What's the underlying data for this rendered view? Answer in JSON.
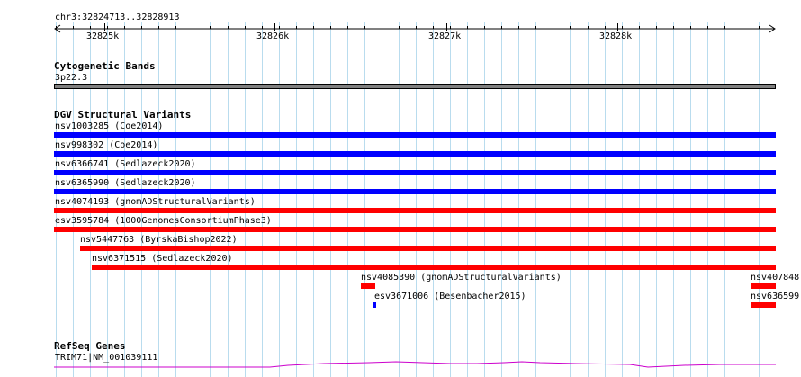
{
  "ruler": {
    "region": "chr3:32824713..32828913",
    "ticks": [
      "32825k",
      "32826k",
      "32827k",
      "32828k"
    ]
  },
  "tracks": {
    "cyto": {
      "title": "Cytogenetic Bands",
      "band_label": "3p22.3",
      "band_color": "#808080"
    },
    "dgv": {
      "title": "DGV Structural Variants",
      "features": [
        {
          "label": "nsv1003285 (Coe2014)",
          "color": "#0000ff"
        },
        {
          "label": "nsv998302 (Coe2014)",
          "color": "#0000ff"
        },
        {
          "label": "nsv6366741 (Sedlazeck2020)",
          "color": "#0000ff"
        },
        {
          "label": "nsv6365990 (Sedlazeck2020)",
          "color": "#0000ff"
        },
        {
          "label": "nsv4074193 (gnomADStructuralVariants)",
          "color": "#ff0000"
        },
        {
          "label": "esv3595784 (1000GenomesConsortiumPhase3)",
          "color": "#ff0000"
        },
        {
          "label": "nsv5447763 (ByrskaBishop2022)",
          "color": "#ff0000"
        },
        {
          "label": "nsv6371515 (Sedlazeck2020)",
          "color": "#ff0000"
        },
        {
          "label": "nsv4085390 (gnomADStructuralVariants)",
          "color": "#ff0000"
        },
        {
          "label": "esv3671006 (Besenbacher2015)",
          "color": "#0000ff"
        },
        {
          "label": "nsv407848",
          "color": "#ff0000"
        },
        {
          "label": "nsv636599",
          "color": "#ff0000"
        }
      ]
    },
    "refseq": {
      "title": "RefSeq Genes",
      "gene_label": "TRIM71|NM_001039111",
      "gene_color": "#cc00cc"
    }
  }
}
